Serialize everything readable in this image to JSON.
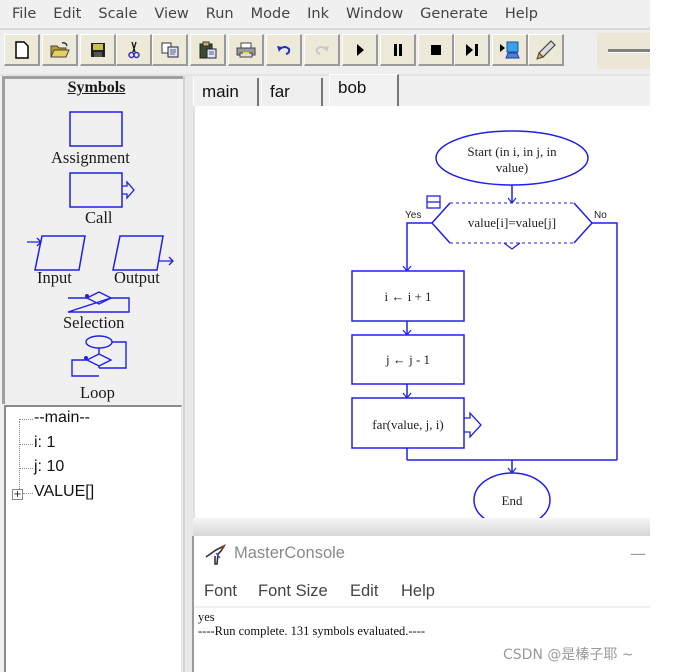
{
  "menubar": {
    "items": [
      "File",
      "Edit",
      "Scale",
      "View",
      "Run",
      "Mode",
      "Ink",
      "Window",
      "Generate",
      "Help"
    ]
  },
  "toolbar": {
    "buttons": [
      {
        "name": "new",
        "icon": "new-file-icon"
      },
      {
        "name": "open",
        "icon": "open-folder-icon"
      },
      {
        "name": "save",
        "icon": "floppy-disk-icon"
      },
      {
        "name": "cut",
        "icon": "scissors-icon"
      },
      {
        "name": "copy",
        "icon": "copy-icon"
      },
      {
        "name": "paste",
        "icon": "paste-clipboard-icon"
      },
      {
        "name": "print",
        "icon": "printer-icon"
      },
      {
        "name": "undo",
        "icon": "undo-icon"
      },
      {
        "name": "redo",
        "icon": "redo-icon",
        "disabled": true
      },
      {
        "name": "run",
        "icon": "play-icon"
      },
      {
        "name": "pause",
        "icon": "pause-icon"
      },
      {
        "name": "stop",
        "icon": "stop-icon"
      },
      {
        "name": "step",
        "icon": "step-icon"
      },
      {
        "name": "run-to-computer",
        "icon": "computer-run-icon"
      },
      {
        "name": "ink",
        "icon": "pen-icon"
      }
    ],
    "speed_slider": "speed-slider"
  },
  "symbols": {
    "title": "Symbols",
    "items": [
      "Assignment",
      "Call",
      "Input",
      "Output",
      "Selection",
      "Loop"
    ]
  },
  "variables": {
    "items": [
      "--main--",
      "i: 1",
      "j: 10",
      "VALUE[]"
    ]
  },
  "tabs": {
    "items": [
      "main",
      "far",
      "bob"
    ],
    "active": "bob"
  },
  "flowchart": {
    "start": [
      "Start (in i, in j, in",
      "value)"
    ],
    "decision": "value[i]=value[j]",
    "yes_label": "Yes",
    "no_label": "No",
    "steps": [
      "i ← i + 1",
      "j ← j - 1",
      "far(value, j, i)"
    ],
    "end": "End",
    "color": "#2020e8"
  },
  "console": {
    "title": "MasterConsole",
    "minimize": "—",
    "menu": [
      "Font",
      "Font Size",
      "Edit",
      "Help"
    ],
    "output": [
      "yes",
      "----Run complete.  131 symbols evaluated.----"
    ]
  },
  "watermark": "CSDN @是榛子耶 ~"
}
